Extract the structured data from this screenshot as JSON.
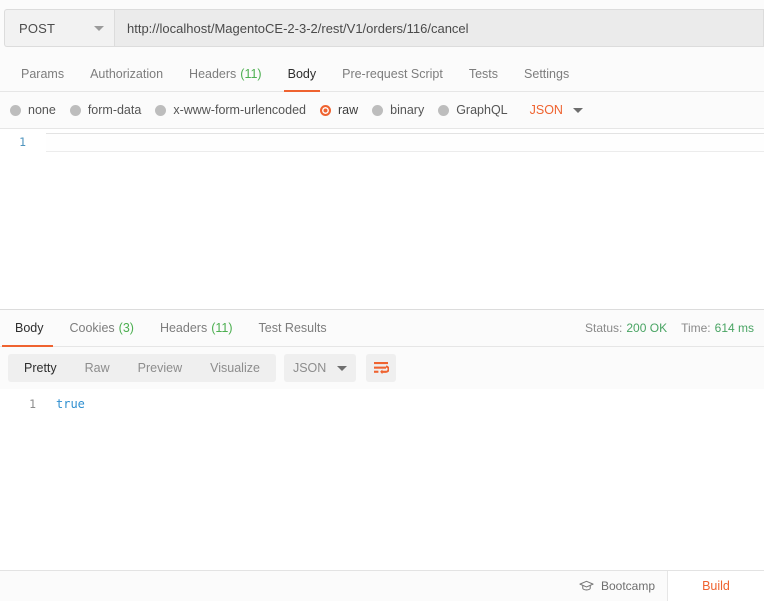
{
  "request": {
    "method": "POST",
    "url": "http://localhost/MagentoCE-2-3-2/rest/V1/orders/116/cancel",
    "tabs": [
      {
        "label": "Params",
        "count": "",
        "active": false
      },
      {
        "label": "Authorization",
        "count": "",
        "active": false
      },
      {
        "label": "Headers",
        "count": "(11)",
        "active": false
      },
      {
        "label": "Body",
        "count": "",
        "active": true
      },
      {
        "label": "Pre-request Script",
        "count": "",
        "active": false
      },
      {
        "label": "Tests",
        "count": "",
        "active": false
      },
      {
        "label": "Settings",
        "count": "",
        "active": false
      }
    ],
    "body_types": [
      {
        "label": "none",
        "selected": false
      },
      {
        "label": "form-data",
        "selected": false
      },
      {
        "label": "x-www-form-urlencoded",
        "selected": false
      },
      {
        "label": "raw",
        "selected": true
      },
      {
        "label": "binary",
        "selected": false
      },
      {
        "label": "GraphQL",
        "selected": false
      }
    ],
    "raw_format": "JSON",
    "editor": {
      "line_number": "1",
      "content": ""
    }
  },
  "response": {
    "tabs": [
      {
        "label": "Body",
        "count": "",
        "active": true
      },
      {
        "label": "Cookies",
        "count": "(3)",
        "active": false
      },
      {
        "label": "Headers",
        "count": "(11)",
        "active": false
      },
      {
        "label": "Test Results",
        "count": "",
        "active": false
      }
    ],
    "status_label": "Status:",
    "status_value": "200 OK",
    "time_label": "Time:",
    "time_value": "614 ms",
    "view_modes": [
      {
        "label": "Pretty",
        "active": true
      },
      {
        "label": "Raw",
        "active": false
      },
      {
        "label": "Preview",
        "active": false
      },
      {
        "label": "Visualize",
        "active": false
      }
    ],
    "format": "JSON",
    "wrap_icon": "word-wrap-icon",
    "body": {
      "line_number": "1",
      "value": "true"
    }
  },
  "footer": {
    "bootcamp_label": "Bootcamp",
    "bootcamp_icon": "graduation-cap-icon",
    "build_label": "Build"
  },
  "colors": {
    "accent": "#ef6330",
    "success": "#49a463",
    "code_blue": "#2f8fd0"
  }
}
